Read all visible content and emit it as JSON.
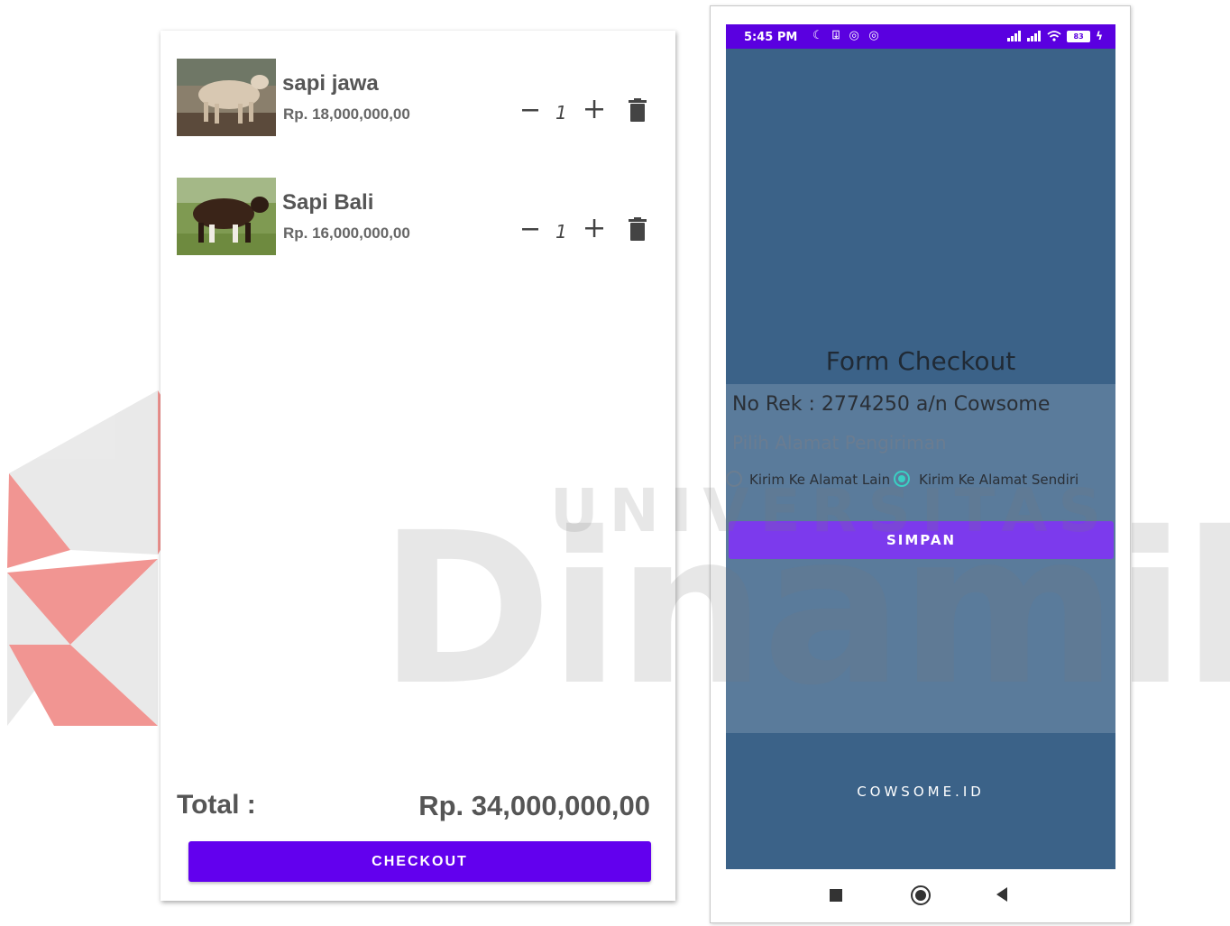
{
  "watermark": {
    "word_top": "UNIVERSITAS",
    "word_main": "Dinamika"
  },
  "cart": {
    "items": [
      {
        "name": "sapi jawa",
        "price": "Rp. 18,000,000,00",
        "qty": "1"
      },
      {
        "name": "Sapi Bali",
        "price": "Rp. 16,000,000,00",
        "qty": "1"
      }
    ],
    "total_label": "Total :",
    "total_value": "Rp. 34,000,000,00",
    "checkout_label": "CHECKOUT"
  },
  "phone": {
    "status": {
      "time": "5:45 PM",
      "left_icons": "☾ ⍗ ◎ ◎",
      "battery": "83"
    },
    "form": {
      "title": "Form Checkout",
      "rekening": "No Rek : 2774250 a/n Cowsome",
      "alamat_hint": "Pilih Alamat Pengiriman",
      "option_lain": "Kirim Ke Alamat Lain",
      "option_sendiri": "Kirim Ke Alamat Sendiri",
      "selected": "Kirim Ke Alamat Sendiri",
      "submit_label": "SIMPAN"
    },
    "footer": "COWSOME.ID"
  },
  "colors": {
    "checkout": "#6200ee",
    "statusbar": "#5a00e0",
    "app_background": "#3b6288",
    "simpan": "#7c3aed",
    "radio_selected": "#3ad0c3",
    "watermark_red": "#e8504a"
  },
  "icons": {
    "qty_minus": "minus-icon",
    "qty_plus": "plus-icon",
    "delete": "trash-icon",
    "nav_recents": "square-icon",
    "nav_home": "circle-icon",
    "nav_back": "triangle-back-icon"
  }
}
